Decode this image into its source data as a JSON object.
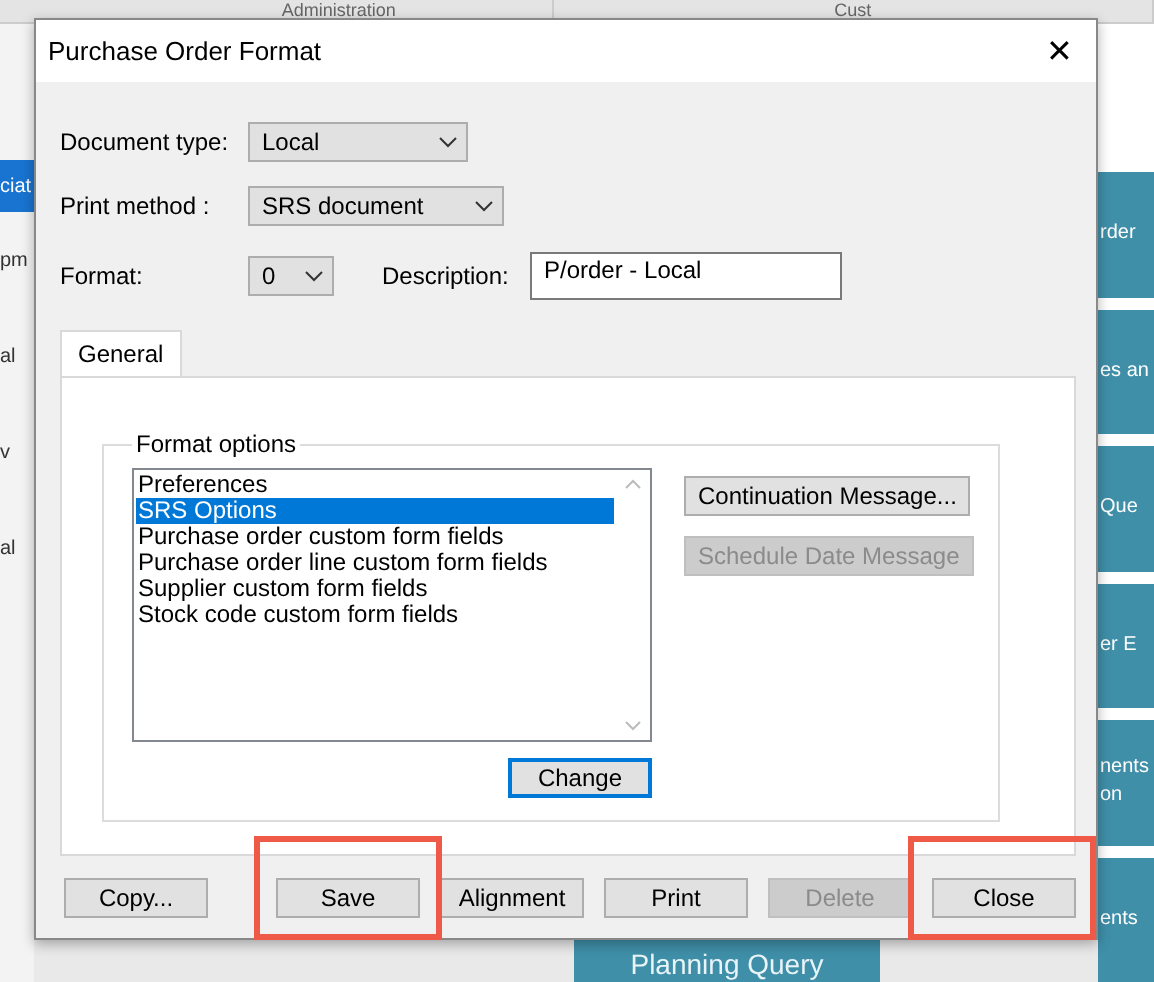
{
  "background": {
    "header": [
      "Administration",
      "Cust"
    ],
    "left_fragments": [
      {
        "text": "ciat",
        "selected": true
      },
      {
        "text": "pm",
        "selected": false
      },
      {
        "text": "al",
        "selected": false
      },
      {
        "text": "v",
        "selected": false
      },
      {
        "text": "al",
        "selected": false
      }
    ],
    "right_tiles": [
      {
        "lines": [
          "rder"
        ]
      },
      {
        "lines": [
          "es an"
        ]
      },
      {
        "lines": [
          "Que"
        ]
      },
      {
        "lines": [
          "er E"
        ]
      },
      {
        "lines": [
          "nents",
          "on"
        ]
      },
      {
        "lines": [
          "ents"
        ]
      }
    ],
    "bottom_tile": "Planning Query"
  },
  "dialog": {
    "title": "Purchase Order Format",
    "close": "✕",
    "fields": [
      {
        "kind": "combo",
        "label": "Document type:",
        "value": "Local"
      },
      {
        "kind": "combo",
        "label": "Print method :",
        "value": "SRS document"
      }
    ],
    "format": {
      "label": "Format:",
      "value": "0"
    },
    "description": {
      "label": "Description:",
      "value": "P/order - Local"
    },
    "tabs": [
      {
        "label": "General",
        "selected": true
      }
    ],
    "group_title": "Format options",
    "options": [
      {
        "label": "Preferences",
        "selected": false
      },
      {
        "label": "SRS Options",
        "selected": true
      },
      {
        "label": "Purchase order custom form fields",
        "selected": false
      },
      {
        "label": "Purchase order line custom form fields",
        "selected": false
      },
      {
        "label": "Supplier custom form fields",
        "selected": false
      },
      {
        "label": "Stock code custom form fields",
        "selected": false
      }
    ],
    "side_buttons": [
      {
        "label": "Continuation Message...",
        "disabled": false
      },
      {
        "label": "Schedule Date Message",
        "disabled": true
      }
    ],
    "change_button": "Change",
    "buttons": [
      {
        "label": "Copy...",
        "disabled": false,
        "highlighted": false
      },
      {
        "label": "Save",
        "disabled": false,
        "highlighted": true
      },
      {
        "label": "Alignment",
        "disabled": false,
        "highlighted": false
      },
      {
        "label": "Print",
        "disabled": false,
        "highlighted": false
      },
      {
        "label": "Delete",
        "disabled": true,
        "highlighted": false
      },
      {
        "label": "Close",
        "disabled": false,
        "highlighted": true
      }
    ]
  }
}
